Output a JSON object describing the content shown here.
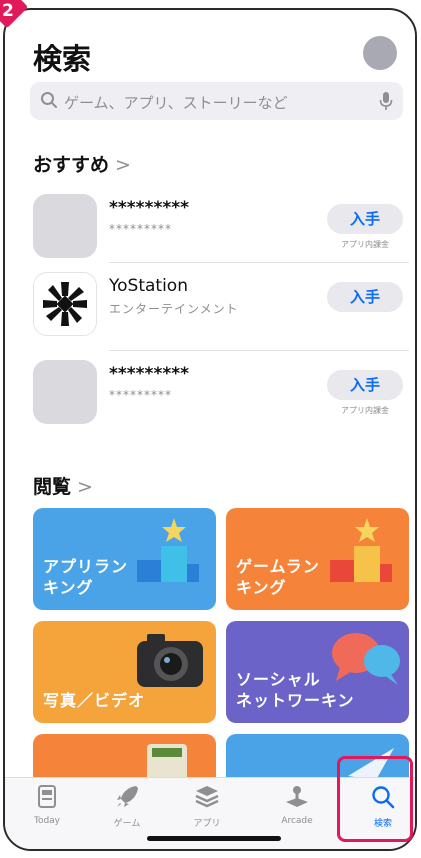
{
  "step_badge": "2",
  "header": {
    "title": "検索"
  },
  "search": {
    "placeholder": "ゲーム、アプリ、ストーリーなど"
  },
  "recommended": {
    "title": "おすすめ",
    "chevron": ">",
    "apps": [
      {
        "name": "*********",
        "subtitle": "*********",
        "button": "入手",
        "note": "アプリ内課金"
      },
      {
        "name": "YoStation",
        "subtitle": "エンターテインメント",
        "button": "入手",
        "note": ""
      },
      {
        "name": "*********",
        "subtitle": "*********",
        "button": "入手",
        "note": "アプリ内課金"
      }
    ]
  },
  "browse": {
    "title": "閲覧",
    "chevron": ">",
    "categories": [
      {
        "label_line1": "アプリラン",
        "label_line2": "キング",
        "color": "#4aa3e6"
      },
      {
        "label_line1": "ゲームラン",
        "label_line2": "キング",
        "color": "#f5843a"
      },
      {
        "label_line1": "",
        "label_line2": "写真／ビデオ",
        "color": "#f5a33b"
      },
      {
        "label_line1": "ソーシャル",
        "label_line2": "ネットワーキン",
        "color": "#6b63c7"
      },
      {
        "label_line1": "",
        "label_line2": "",
        "color": "#f5843a"
      },
      {
        "label_line1": "",
        "label_line2": "",
        "color": "#4aa3e6"
      }
    ]
  },
  "tabbar": {
    "tabs": [
      {
        "label": "Today",
        "icon": "today-icon"
      },
      {
        "label": "ゲーム",
        "icon": "rocket-icon"
      },
      {
        "label": "アプリ",
        "icon": "apps-stack-icon"
      },
      {
        "label": "Arcade",
        "icon": "joystick-icon"
      },
      {
        "label": "検索",
        "icon": "search-icon",
        "active": true
      }
    ]
  },
  "colors": {
    "accent": "#0a6cf5",
    "highlight": "#e0195a"
  }
}
